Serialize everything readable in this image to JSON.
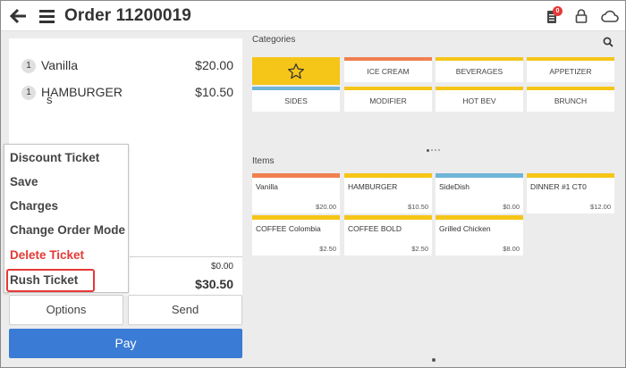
{
  "header": {
    "title": "Order 11200019",
    "badge_count": "0",
    "icons": [
      "back-arrow-icon",
      "menu-icon",
      "ticket-icon",
      "lock-icon",
      "cloud-icon"
    ]
  },
  "ticket": {
    "items": [
      {
        "qty": "1",
        "name": "Vanilla",
        "price": "$20.00"
      },
      {
        "qty": "1",
        "name": "HAMBURGER",
        "price": "$10.50",
        "modifier": "s"
      }
    ],
    "zero_amount": "$0.00",
    "total": "$30.50"
  },
  "options_menu": {
    "items": [
      "Discount Ticket",
      "Save",
      "Charges",
      "Change Order Mode",
      "Delete Ticket",
      "Rush Ticket"
    ],
    "highlighted": "Rush Ticket"
  },
  "buttons": {
    "options": "Options",
    "send": "Send",
    "pay": "Pay"
  },
  "categories": {
    "label": "Categories",
    "tiles": [
      {
        "label": "",
        "icon": "star-icon",
        "color": "#f5c518"
      },
      {
        "label": "ICE CREAM",
        "color": "#f08050"
      },
      {
        "label": "BEVERAGES",
        "color": "#f5c518"
      },
      {
        "label": "APPETIZER",
        "color": "#f5c518"
      },
      {
        "label": "SIDES",
        "color": "#6fb5d8"
      },
      {
        "label": "MODIFIER",
        "color": "#f5c518"
      },
      {
        "label": "HOT BEV",
        "color": "#f5c518"
      },
      {
        "label": "BRUNCH",
        "color": "#f5c518"
      }
    ]
  },
  "items": {
    "label": "Items",
    "tiles": [
      {
        "name": "Vanilla",
        "price": "$20.00",
        "color": "#f08050"
      },
      {
        "name": "HAMBURGER",
        "price": "$10.50",
        "color": "#f5c518"
      },
      {
        "name": "SideDish",
        "price": "$0.00",
        "color": "#6fb5d8"
      },
      {
        "name": "DINNER #1 CT0",
        "price": "$12.00",
        "color": "#f5c518"
      },
      {
        "name": "COFFEE Colombia",
        "price": "$2.50",
        "color": "#f5c518"
      },
      {
        "name": "COFFEE BOLD",
        "price": "$2.50",
        "color": "#f5c518"
      },
      {
        "name": "Grilled Chicken",
        "price": "$8.00",
        "color": "#f5c518"
      }
    ]
  },
  "colors": {
    "accent": "#3a7bd5",
    "danger": "#e53935",
    "category_yellow": "#f5c518"
  }
}
